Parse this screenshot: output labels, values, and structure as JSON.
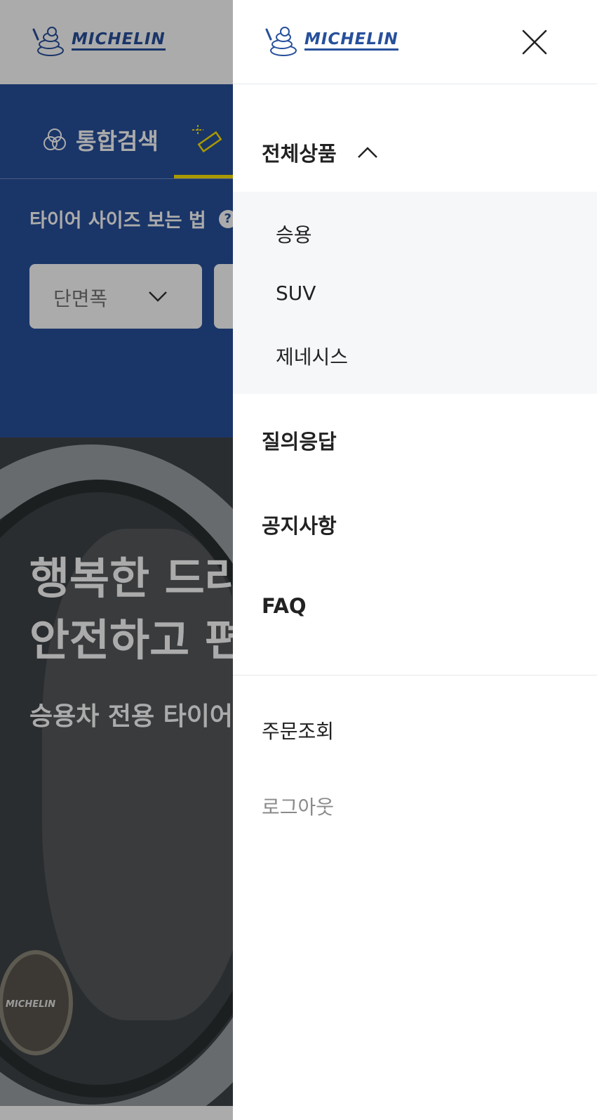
{
  "brand": {
    "logo_text": "MICHELIN"
  },
  "background": {
    "tabs": {
      "integrated_search": "통합검색"
    },
    "tire_size_howto": "타이어 사이즈 보는 법",
    "help_icon": "?",
    "selects": {
      "section_width": "단면폭"
    },
    "hero": {
      "line1": "행복한 드라",
      "line2": "안전하고 편",
      "subtitle": "승용차 전용 타이어"
    },
    "cap_text": "MICHELIN"
  },
  "drawer": {
    "close_icon": "close-icon",
    "menu": {
      "all_products": "전체상품",
      "submenu": [
        "승용",
        "SUV",
        "제네시스"
      ],
      "qna": "질의응답",
      "notice": "공지사항",
      "faq": "FAQ"
    },
    "utility": {
      "order_lookup": "주문조회",
      "logout": "로그아웃"
    }
  },
  "colors": {
    "brand_blue": "#27509b",
    "accent_yellow": "#fce500",
    "submenu_bg": "#f6f7f9",
    "overlay": "rgba(0,0,0,0.33)"
  }
}
